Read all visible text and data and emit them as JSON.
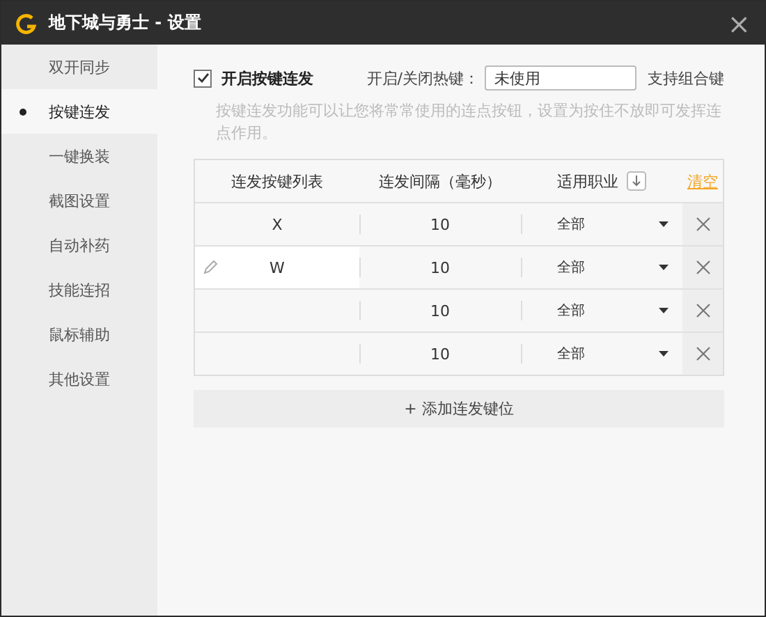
{
  "window": {
    "title": "地下城与勇士 - 设置",
    "close": "×"
  },
  "sidebar": {
    "items": [
      {
        "label": "双开同步",
        "selected": false
      },
      {
        "label": "按键连发",
        "selected": true
      },
      {
        "label": "一键换装",
        "selected": false
      },
      {
        "label": "截图设置",
        "selected": false
      },
      {
        "label": "自动补药",
        "selected": false
      },
      {
        "label": "技能连招",
        "selected": false
      },
      {
        "label": "鼠标辅助",
        "selected": false
      },
      {
        "label": "其他设置",
        "selected": false
      }
    ]
  },
  "enable": {
    "label": "开启按键连发",
    "checked": true
  },
  "hotkey": {
    "label": "开启/关闭热键：",
    "value": "未使用",
    "note": "支持组合键"
  },
  "description": "按键连发功能可以让您将常常使用的连点按钮，设置为按住不放即可发挥连点作用。",
  "table": {
    "columns": [
      "连发按键列表",
      "连发间隔（毫秒）",
      "适用职业"
    ],
    "clear": "清空",
    "rows": [
      {
        "key": "X",
        "interval": "10",
        "job": "全部",
        "editing": false
      },
      {
        "key": "W",
        "interval": "10",
        "job": "全部",
        "editing": true
      },
      {
        "key": "",
        "interval": "10",
        "job": "全部",
        "editing": false
      },
      {
        "key": "",
        "interval": "10",
        "job": "全部",
        "editing": false
      }
    ]
  },
  "add_button": "+ 添加连发键位"
}
